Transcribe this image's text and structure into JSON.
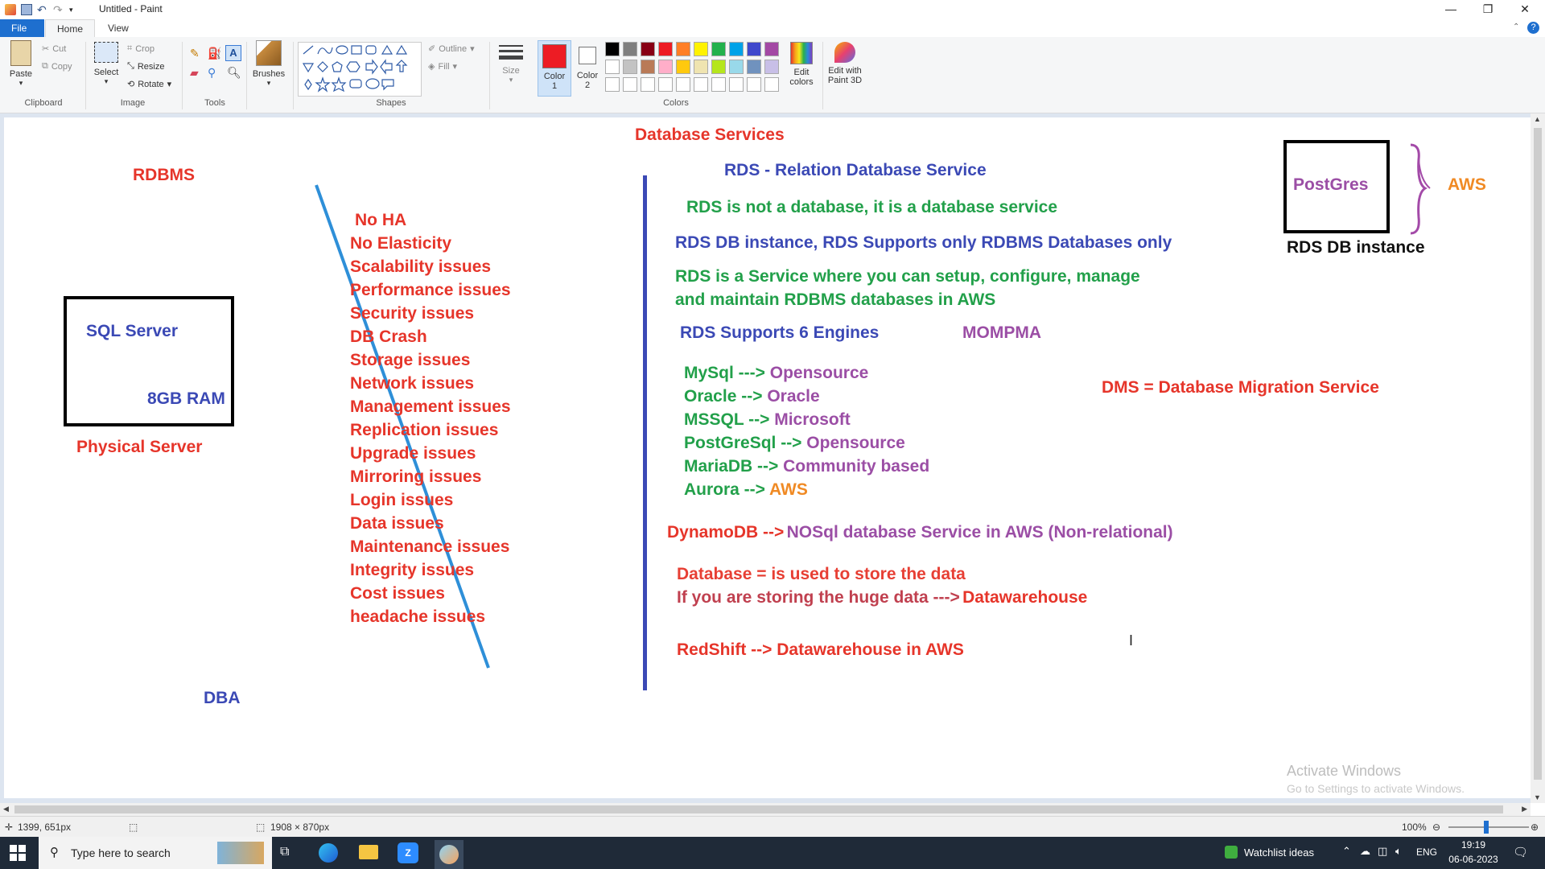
{
  "window": {
    "title": "Untitled - Paint"
  },
  "ribbon": {
    "tabs": [
      "File",
      "Home",
      "View"
    ],
    "clipboard": {
      "paste": "Paste",
      "cut": "Cut",
      "copy": "Copy",
      "label": "Clipboard"
    },
    "image": {
      "select": "Select",
      "crop": "Crop",
      "resize": "Resize",
      "rotate": "Rotate",
      "label": "Image"
    },
    "tools": {
      "label": "Tools"
    },
    "brushes": "Brushes",
    "shapes": {
      "outline": "Outline",
      "fill": "Fill",
      "label": "Shapes"
    },
    "size": "Size",
    "color1": "Color\n1",
    "color1_l1": "Color",
    "color1_l2": "1",
    "color2_l1": "Color",
    "color2_l2": "2",
    "colors_label": "Colors",
    "edit_colors_l1": "Edit",
    "edit_colors_l2": "colors",
    "paint3d_l1": "Edit with",
    "paint3d_l2": "Paint 3D",
    "palette_row1": [
      "#000000",
      "#7f7f7f",
      "#880015",
      "#ed1c24",
      "#ff7f27",
      "#fff200",
      "#22b14c",
      "#00a2e8",
      "#3f48cc",
      "#a349a4"
    ],
    "palette_row2": [
      "#ffffff",
      "#c3c3c3",
      "#b97a57",
      "#ffaec9",
      "#ffc90e",
      "#efe4b0",
      "#b5e61d",
      "#99d9ea",
      "#7092be",
      "#c8bfe7"
    ],
    "color1_value": "#ed1c24",
    "color2_value": "#ffffff"
  },
  "canvas": {
    "heading": "Database Services",
    "rdbms": "RDBMS",
    "sql_server": "SQL Server",
    "ram": "8GB RAM",
    "physical_server": "Physical Server",
    "dba": "DBA",
    "issues": [
      "No HA",
      "No Elasticity",
      "Scalability issues",
      "Performance issues",
      "Security issues",
      "DB Crash",
      "Storage issues",
      "Network issues",
      "Management issues",
      "Replication issues",
      "Upgrade issues",
      "Mirroring issues",
      "Login issues",
      "Data issues",
      "Maintenance issues",
      "Integrity issues",
      "Cost issues",
      "headache issues"
    ],
    "rds_title": "RDS - Relation Database Service",
    "rds_not_db": "RDS is not a database, it is a database service",
    "rds_instance_line": "RDS DB instance, RDS Supports only RDBMS Databases only",
    "rds_service_line1": "RDS is a Service where you can setup, configure, manage",
    "rds_service_line2": "and maintain RDBMS databases in AWS",
    "rds_engines": "RDS Supports 6 Engines",
    "mompma": "MOMPMA",
    "engines": [
      {
        "name": "MySql --->",
        "vendor": "Opensource"
      },
      {
        "name": "Oracle -->",
        "vendor": "Oracle"
      },
      {
        "name": "MSSQL -->",
        "vendor": "Microsoft"
      },
      {
        "name": "PostGreSql -->",
        "vendor": "Opensource"
      },
      {
        "name": "MariaDB -->",
        "vendor": "Community based"
      },
      {
        "name": "Aurora -->",
        "vendor": "AWS"
      }
    ],
    "dms": "DMS = Database Migration Service",
    "dynamo_a": "DynamoDB -->",
    "dynamo_b": "NOSql database Service in AWS (Non-relational)",
    "database_def": "Database = is used to store the data",
    "huge_data_a": "If you are storing the huge data --->",
    "huge_data_b": "Datawarehouse",
    "redshift": "RedShift --> Datawarehouse in AWS",
    "postgres": "PostGres",
    "aws": "AWS",
    "rds_db_instance": "RDS DB instance",
    "activate_title": "Activate Windows",
    "activate_sub": "Go to Settings to activate Windows."
  },
  "status": {
    "coords": "1399, 651px",
    "dims": "1908 × 870px",
    "zoom": "100%"
  },
  "taskbar": {
    "search_placeholder": "Type here to search",
    "watchlist": "Watchlist ideas",
    "lang": "ENG",
    "time": "19:19",
    "date": "06-06-2023"
  }
}
